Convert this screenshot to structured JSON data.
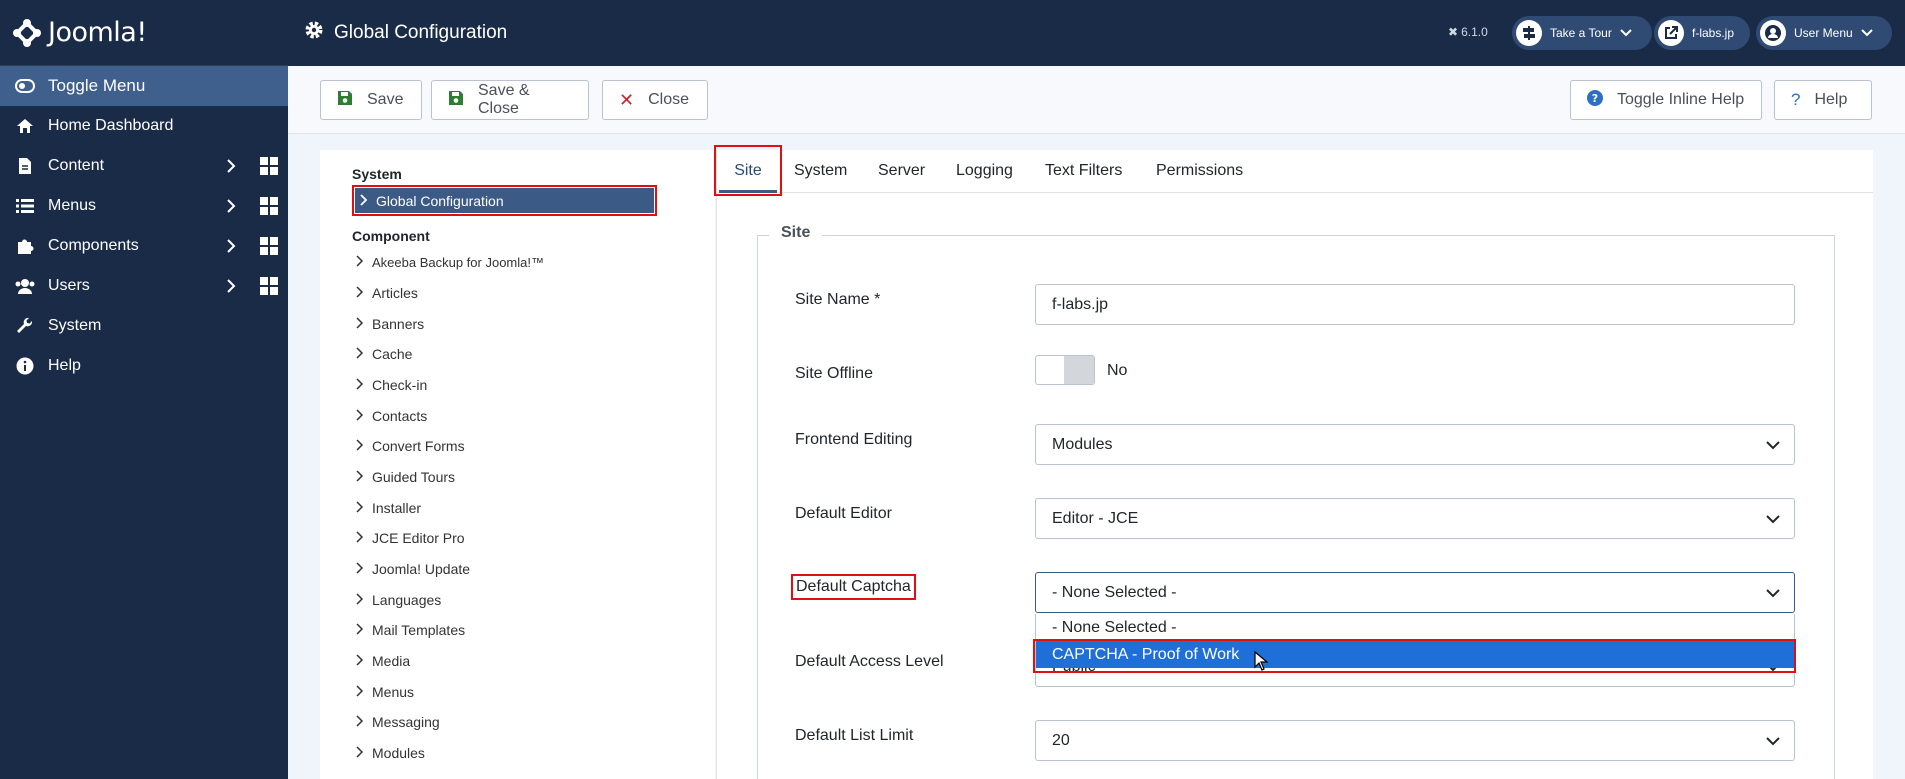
{
  "brand": {
    "name": "Joomla!"
  },
  "sidebar": {
    "toggle_label": "Toggle Menu",
    "items": [
      {
        "label": "Home Dashboard",
        "icon": "home-icon"
      },
      {
        "label": "Content",
        "icon": "file-icon",
        "expandable": true
      },
      {
        "label": "Menus",
        "icon": "list-icon",
        "expandable": true
      },
      {
        "label": "Components",
        "icon": "puzzle-icon",
        "expandable": true
      },
      {
        "label": "Users",
        "icon": "users-icon",
        "expandable": true
      },
      {
        "label": "System",
        "icon": "wrench-icon"
      },
      {
        "label": "Help",
        "icon": "info-icon"
      }
    ]
  },
  "header": {
    "title": "Global Configuration",
    "version": "6.1.0",
    "take_tour": "Take a Tour",
    "site_link": "f-labs.jp",
    "user_menu": "User Menu"
  },
  "toolbar": {
    "save": "Save",
    "save_close": "Save & Close",
    "close": "Close",
    "toggle_help": "Toggle Inline Help",
    "help": "Help"
  },
  "tree": {
    "system_heading": "System",
    "system_active": "Global Configuration",
    "component_heading": "Component",
    "components": [
      "Akeeba Backup for Joomla!™",
      "Articles",
      "Banners",
      "Cache",
      "Check-in",
      "Contacts",
      "Convert Forms",
      "Guided Tours",
      "Installer",
      "JCE Editor Pro",
      "Joomla! Update",
      "Languages",
      "Mail Templates",
      "Media",
      "Menus",
      "Messaging",
      "Modules"
    ]
  },
  "tabs": [
    "Site",
    "System",
    "Server",
    "Logging",
    "Text Filters",
    "Permissions"
  ],
  "form": {
    "legend": "Site",
    "site_name_label": "Site Name *",
    "site_name_value": "f-labs.jp",
    "site_offline_label": "Site Offline",
    "site_offline_value": "No",
    "frontend_editing_label": "Frontend Editing",
    "frontend_editing_value": "Modules",
    "default_editor_label": "Default Editor",
    "default_editor_value": "Editor - JCE",
    "default_captcha_label": "Default Captcha",
    "default_captcha_value": "- None Selected -",
    "captcha_options": [
      "- None Selected -",
      "CAPTCHA - Proof of Work"
    ],
    "default_access_label": "Default Access Level",
    "default_access_value": "Public",
    "default_list_limit_label": "Default List Limit",
    "default_list_limit_value": "20"
  },
  "colors": {
    "sidebar_bg": "#1a2b47",
    "accent": "#3c5a86",
    "highlight": "#e01010",
    "option_selected": "#1f6fd8"
  }
}
